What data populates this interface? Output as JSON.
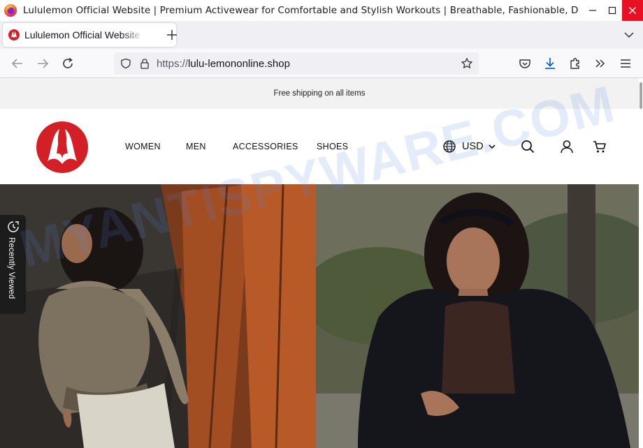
{
  "window": {
    "title": "Lululemon Official Website | Premium Activewear for Comfortable and Stylish Workouts | Breathable, Fashionable, Dyn..."
  },
  "tab": {
    "title": "Lululemon Official Website"
  },
  "navbar": {
    "url_scheme": "https://",
    "url_host": "lulu-lemononline.shop"
  },
  "page": {
    "promo_text": "Free shipping on all items",
    "nav": {
      "women": "WOMEN",
      "men": "MEN",
      "accessories": "ACCESSORIES",
      "shoes": "SHOES"
    },
    "currency": "USD",
    "recently_viewed": "Recently Viewed"
  },
  "watermark": "MYANTISPYWARE.COM",
  "colors": {
    "brand_red": "#d31f26",
    "close_red": "#e81123",
    "download_blue": "#0060df"
  }
}
